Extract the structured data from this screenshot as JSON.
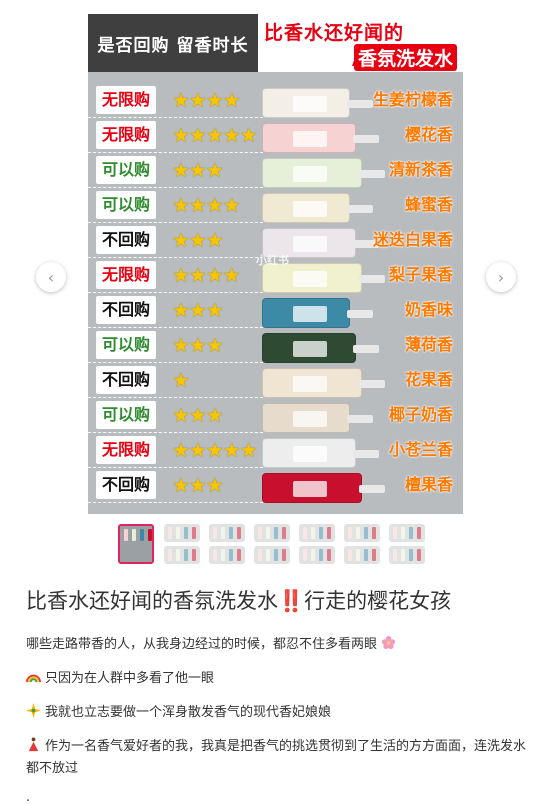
{
  "cover": {
    "header_left": "是否回购 留香时长",
    "header_title_line1": "比香水还好闻的",
    "header_title_line2": "香氛洗发水",
    "watermark": "小红书"
  },
  "rows": [
    {
      "verdict": "无限购",
      "tone": "red",
      "stars": "★★★★",
      "scent": "生姜柠檬香"
    },
    {
      "verdict": "无限购",
      "tone": "red",
      "stars": "★★★★★",
      "scent": "樱花香"
    },
    {
      "verdict": "可以购",
      "tone": "green",
      "stars": "★★★",
      "scent": "清新茶香"
    },
    {
      "verdict": "可以购",
      "tone": "green",
      "stars": "★★★★",
      "scent": "蜂蜜香"
    },
    {
      "verdict": "不回购",
      "tone": "black",
      "stars": "★★★",
      "scent": "迷迭白果香"
    },
    {
      "verdict": "无限购",
      "tone": "red",
      "stars": "★★★★",
      "scent": "梨子果香"
    },
    {
      "verdict": "不回购",
      "tone": "black",
      "stars": "★★★",
      "scent": "奶香味"
    },
    {
      "verdict": "可以购",
      "tone": "green",
      "stars": "★★★",
      "scent": "薄荷香"
    },
    {
      "verdict": "不回购",
      "tone": "black",
      "stars": "★",
      "scent": "花果香"
    },
    {
      "verdict": "可以购",
      "tone": "green",
      "stars": "★★★",
      "scent": "椰子奶香"
    },
    {
      "verdict": "无限购",
      "tone": "red",
      "stars": "★★★★★",
      "scent": "小苍兰香"
    },
    {
      "verdict": "不回购",
      "tone": "black",
      "stars": "★★★",
      "scent": "檀果香"
    }
  ],
  "bottle_colors": [
    "#f3efe6",
    "#f6d2d2",
    "#e6f0d8",
    "#f1ead3",
    "#ece6ea",
    "#f1f0cf",
    "#3d8aa6",
    "#2f4a33",
    "#f0e4d2",
    "#e7dccb",
    "#ededed",
    "#c8102e"
  ],
  "nav": {
    "prev_label": "‹",
    "next_label": "›"
  },
  "thumbnails": {
    "count": 13,
    "active_index": 0
  },
  "post": {
    "title": "比香水还好闻的香氛洗发水‼️行走的樱花女孩",
    "paragraphs": [
      "哪些走路带香的人，从我身边经过的时候，都忍不住多看两眼",
      "只因为在人群中多看了他一眼",
      "我就也立志要做一个浑身散发香气的现代香妃娘娘",
      "作为一名香气爱好者的我，我真是把香气的挑选贯彻到了生活的方方面面，连洗发水都不放过"
    ],
    "paragraph_icons": [
      "cherry-blossom-icon",
      "rainbow-icon",
      "sparkle-icon",
      "dancer-icon"
    ],
    "trailing": "."
  }
}
